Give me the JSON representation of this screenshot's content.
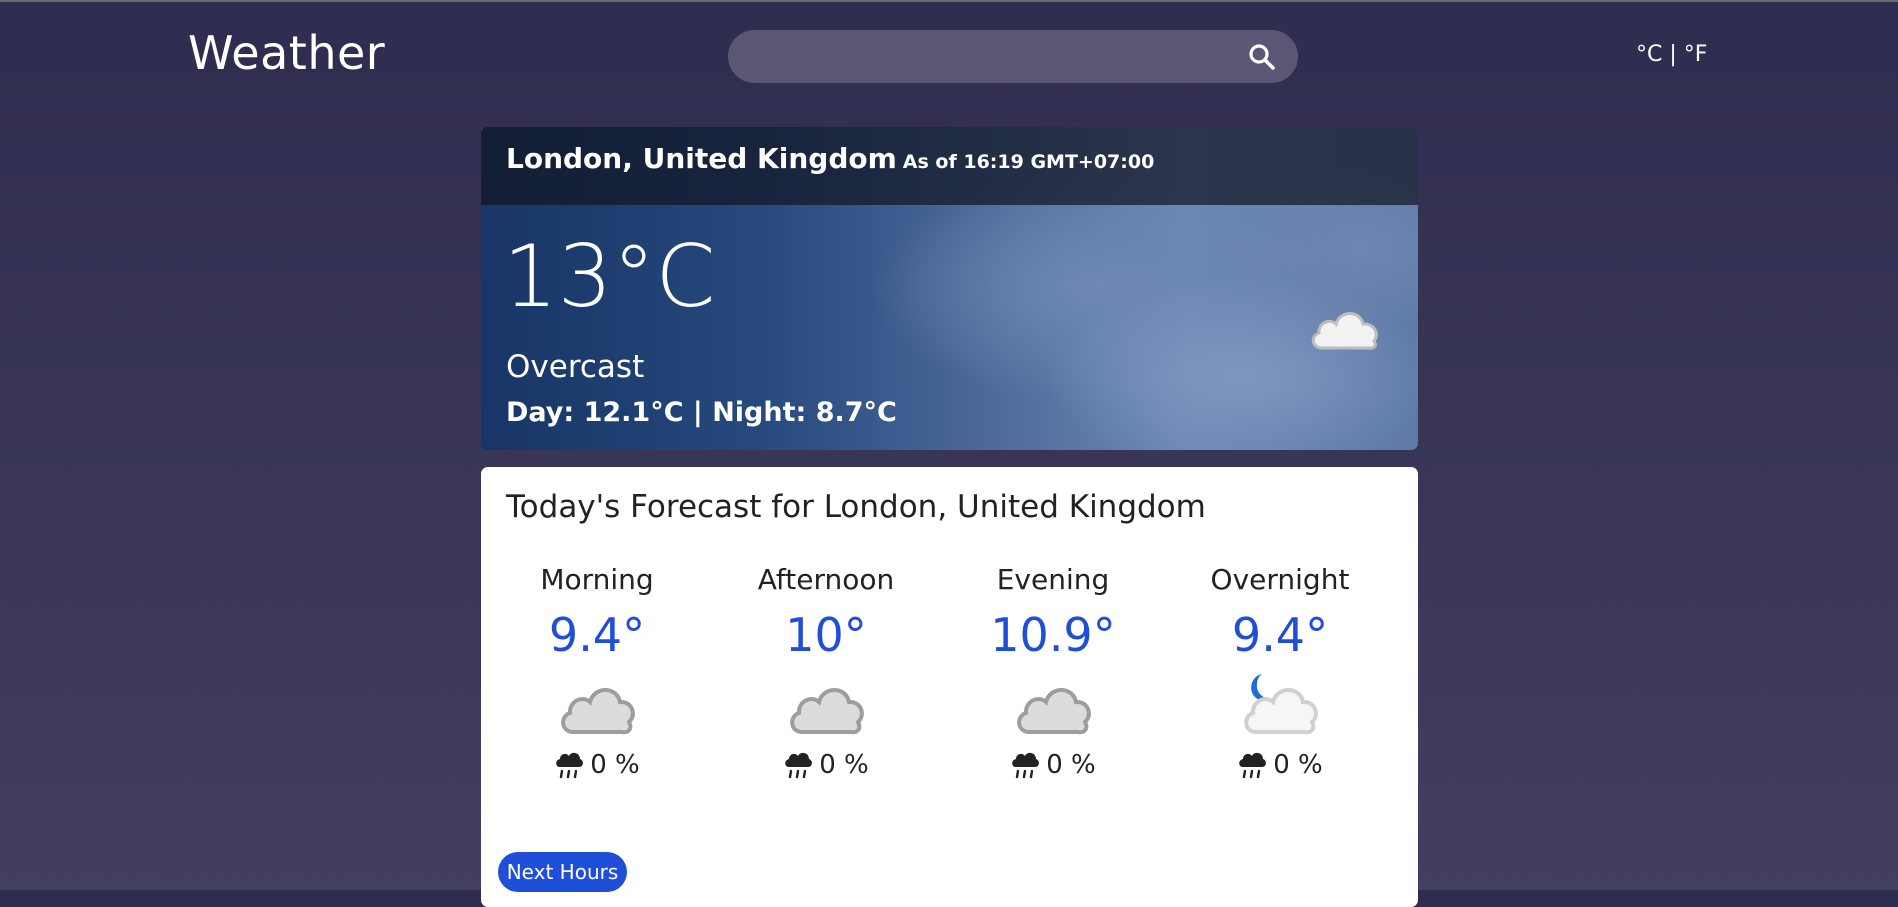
{
  "header": {
    "brand": "Weather",
    "search": {
      "placeholder": "",
      "value": ""
    },
    "units_toggle": "°C | °F"
  },
  "current": {
    "location": "London, United Kingdom",
    "as_of": "As of 16:19 GMT+07:00",
    "temperature": "13°C",
    "condition": "Overcast",
    "day_night": "Day: 12.1°C | Night: 8.7°C",
    "icon": "cloud-icon"
  },
  "forecast": {
    "title": "Today's Forecast for London, United Kingdom",
    "periods": [
      {
        "label": "Morning",
        "temp": "9.4°",
        "icon": "cloud-icon",
        "rain": "0 %"
      },
      {
        "label": "Afternoon",
        "temp": "10°",
        "icon": "cloud-icon",
        "rain": "0 %"
      },
      {
        "label": "Evening",
        "temp": "10.9°",
        "icon": "cloud-icon",
        "rain": "0 %"
      },
      {
        "label": "Overnight",
        "temp": "9.4°",
        "icon": "moon-cloud-icon",
        "rain": "0 %"
      }
    ],
    "next_button": "Next Hours"
  },
  "colors": {
    "accent": "#1f4fd8",
    "background": "#35324f"
  }
}
